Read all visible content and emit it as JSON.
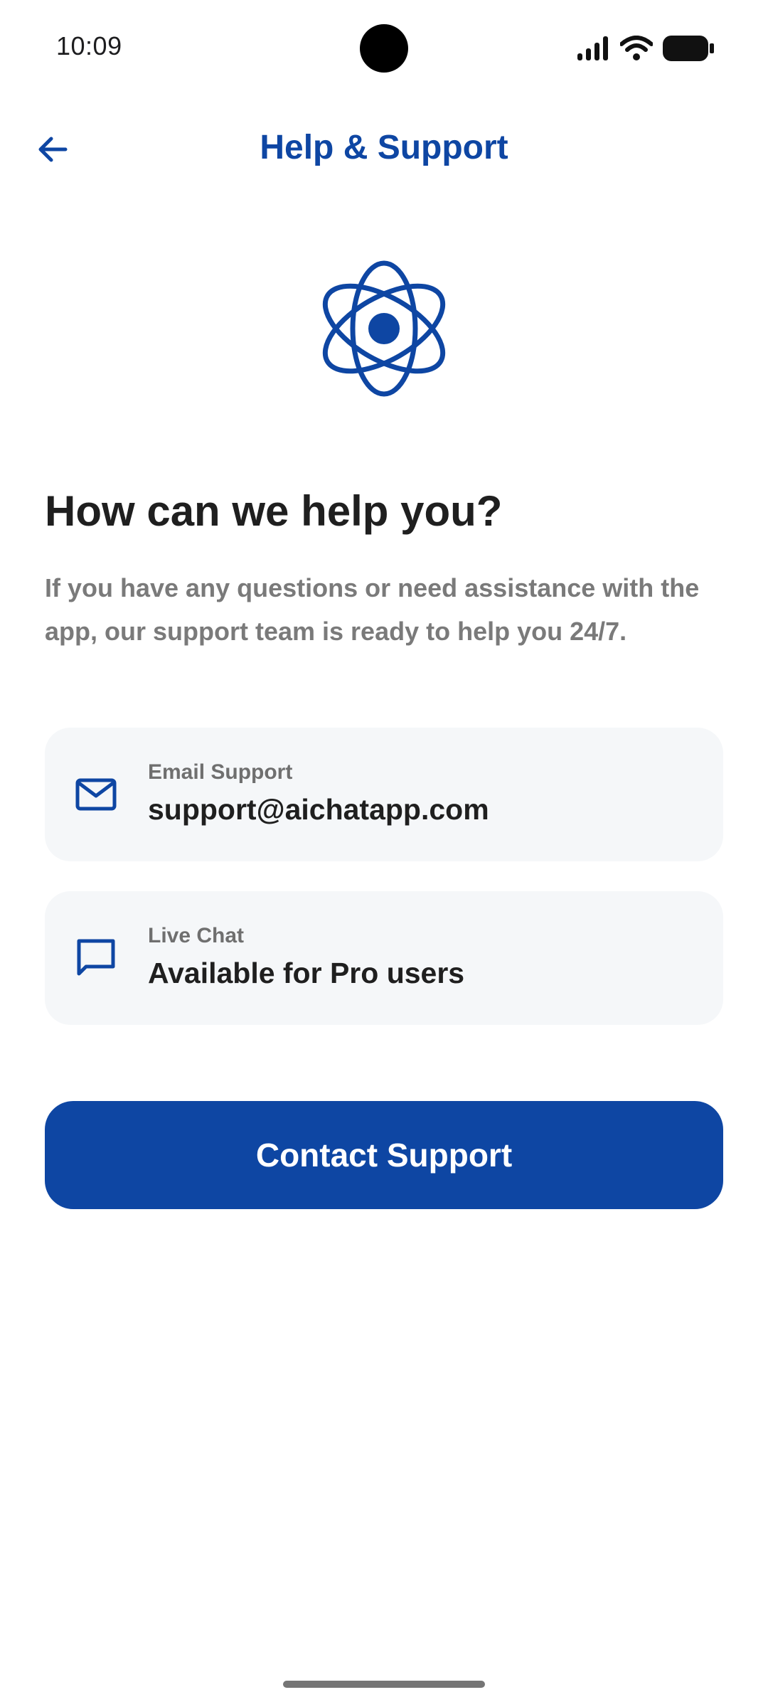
{
  "status_bar": {
    "time": "10:09",
    "icons": [
      "signal-icon",
      "wifi-icon",
      "battery-icon"
    ]
  },
  "app_bar": {
    "title": "Help & Support",
    "back_icon": "arrow-left-icon"
  },
  "main": {
    "logo_icon": "flower-logo-icon",
    "heading": "How can we help you?",
    "description": "If you have any questions or need assistance with the app, our support team is ready to help you 24/7.",
    "cards": [
      {
        "icon": "mail-icon",
        "label": "Email Support",
        "value": "support@aichatapp.com"
      },
      {
        "icon": "chat-bubble-icon",
        "label": "Live Chat",
        "value": "Available for Pro users"
      }
    ],
    "contact_button_label": "Contact Support"
  },
  "colors": {
    "accent": "#0e46a3",
    "card_background": "#f5f7f9",
    "heading_text": "#1f1f1f",
    "secondary_text": "#7a7a7a"
  }
}
